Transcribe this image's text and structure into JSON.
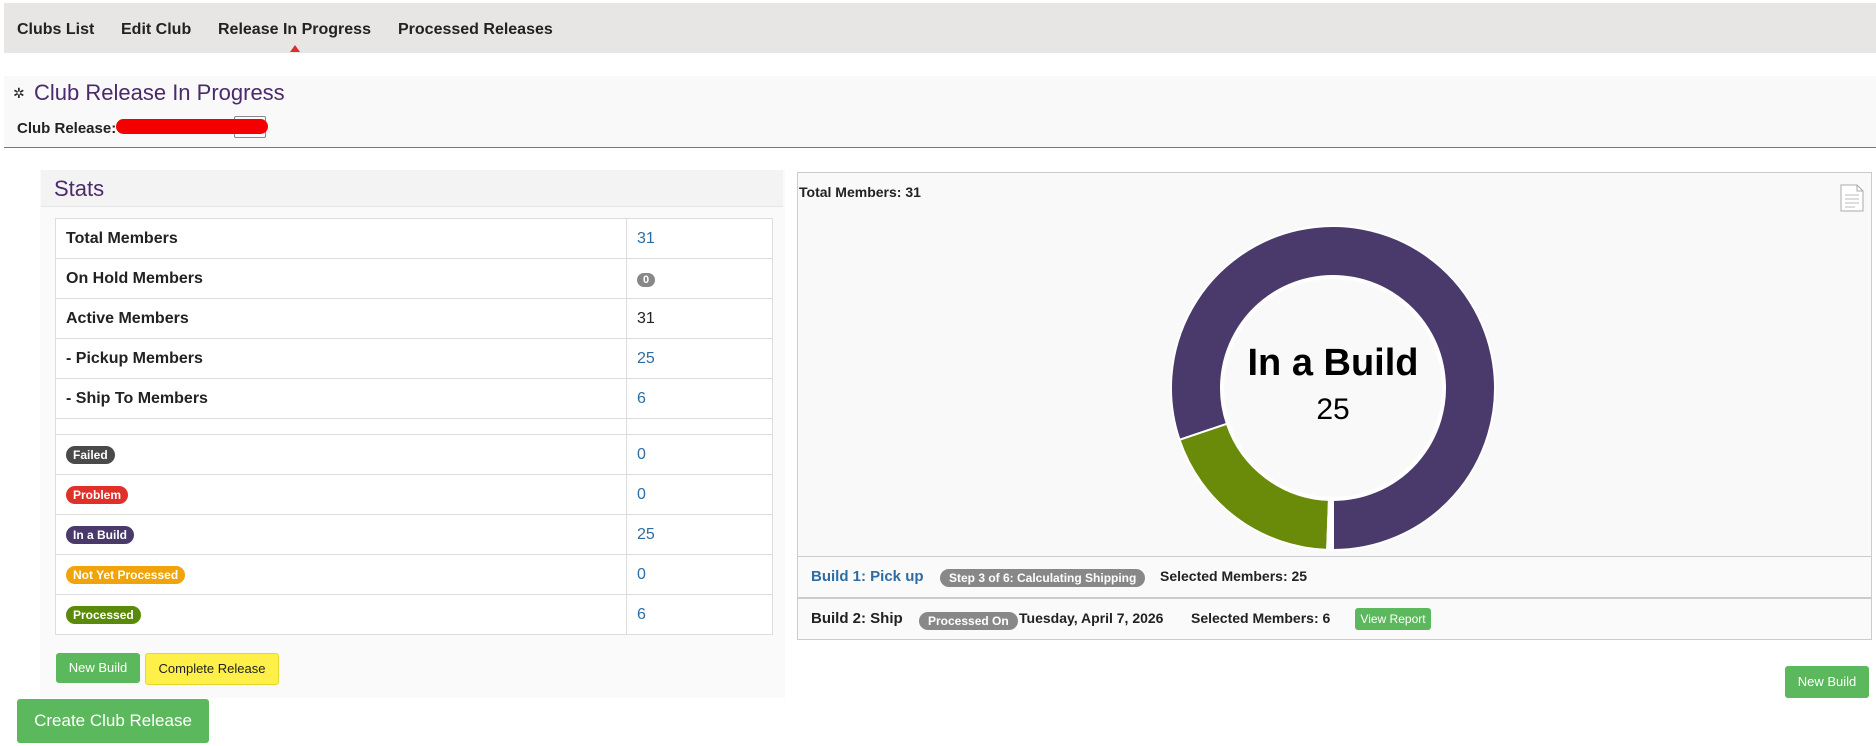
{
  "nav": {
    "items": [
      {
        "label": "Clubs List"
      },
      {
        "label": "Edit Club"
      },
      {
        "label": "Release In Progress"
      },
      {
        "label": "Processed Releases"
      }
    ],
    "active": "Release In Progress"
  },
  "header": {
    "title": "Club Release In Progress",
    "club_release_label": "Club Release:"
  },
  "stats": {
    "title": "Stats",
    "rows": [
      {
        "label": "Total Members",
        "value": "31"
      },
      {
        "label": "On Hold Members",
        "value": "0"
      },
      {
        "label": "Active Members",
        "value": "31"
      },
      {
        "label": "- Pickup Members",
        "value": "25"
      },
      {
        "label": "- Ship To Members",
        "value": "6"
      }
    ],
    "status_rows": [
      {
        "label": "Failed",
        "value": "0",
        "color": "#4a4a4a"
      },
      {
        "label": "Problem",
        "value": "0",
        "color": "#d9302c"
      },
      {
        "label": "In a Build",
        "value": "25",
        "color": "#4a3a6b"
      },
      {
        "label": "Not Yet Processed",
        "value": "0",
        "color": "#f0a30a"
      },
      {
        "label": "Processed",
        "value": "6",
        "color": "#5a8a0a"
      }
    ],
    "new_build_label": "New Build",
    "complete_release_label": "Complete Release"
  },
  "create_club_release_label": "Create Club Release",
  "chart": {
    "total_label": "Total Members: 31",
    "center_title": "In a Build",
    "center_value": "25"
  },
  "chart_data": {
    "type": "pie",
    "categories": [
      "In a Build",
      "Processed",
      "Failed",
      "Problem",
      "Not Yet Processed"
    ],
    "values": [
      25,
      6,
      0,
      0,
      0
    ],
    "colors": [
      "#4a3a6b",
      "#6a8a0a",
      "#4a4a4a",
      "#c0302c",
      "#f0a30a"
    ],
    "title": "",
    "center_label": "In a Build",
    "center_value": 25
  },
  "builds": [
    {
      "name": "Build 1: Pick up",
      "badge": "Step 3 of 6: Calculating Shipping",
      "selected": "Selected Members: 25"
    },
    {
      "name": "Build 2: Ship",
      "badge": "Processed On",
      "date": "Tuesday, April 7, 2026",
      "selected": "Selected Members: 6",
      "report_label": "View Report"
    }
  ],
  "new_build_right_label": "New Build"
}
